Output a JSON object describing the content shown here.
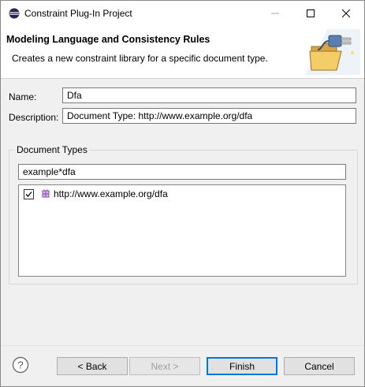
{
  "window": {
    "title": "Constraint Plug-In Project"
  },
  "banner": {
    "title": "Modeling Language and Consistency Rules",
    "description": "Creates a new constraint library for a specific document type."
  },
  "form": {
    "name_label": "Name:",
    "name_value": "Dfa",
    "description_label": "Description:",
    "description_value": "Document Type: http://www.example.org/dfa"
  },
  "document_types": {
    "group_label": "Document Types",
    "filter_value": "example*dfa",
    "items": [
      {
        "label": "http://www.example.org/dfa",
        "checked": true,
        "icon": "package-icon"
      }
    ]
  },
  "footer": {
    "back_label": "< Back",
    "next_label": "Next >",
    "finish_label": "Finish",
    "cancel_label": "Cancel"
  },
  "colors": {
    "accent": "#0078d7",
    "package_icon": "#8e44ad"
  }
}
